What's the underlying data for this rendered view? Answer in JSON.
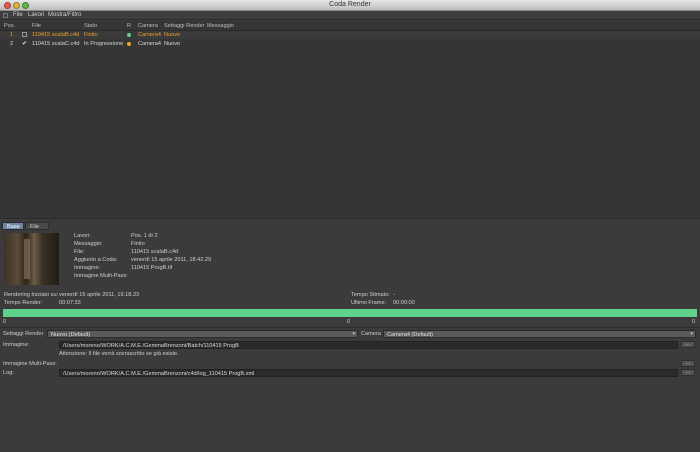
{
  "window": {
    "title": "Coda Render"
  },
  "menu": {
    "items": [
      "File",
      "Lavori",
      "Mostra/Filtro"
    ]
  },
  "jobs": {
    "columns": {
      "pos": "Pos.",
      "file": "File",
      "stato": "Stato",
      "r": "R",
      "camera": "Camera",
      "settaggi": "Settaggi Render",
      "messaggio": "Messaggio"
    },
    "rows": [
      {
        "pos": "1",
        "file": "110415 scalaB.c4d",
        "stato": "Finito",
        "camera": "Camera4",
        "settaggi": "Nuovo",
        "dot_color": "#5fd18c",
        "text_color": "#f0a326"
      },
      {
        "pos": "2",
        "file": "110415 scalaC.c4d",
        "stato": "In Progressione",
        "camera": "Camera4",
        "settaggi": "Nuovo",
        "dot_color": "#f0a326",
        "text_color": "#dadada"
      }
    ]
  },
  "tabs": {
    "base": "Base",
    "file_log": "File Log"
  },
  "details": {
    "lavori_label": "Lavori:",
    "lavori_value": "Pos. 1 di 2",
    "messaggio_label": "Messaggio:",
    "messaggio_value": "Finito",
    "file_label": "File:",
    "file_value": "110415 scalaB.c4d",
    "aggiunto_label": "Aggiunto a Coda:",
    "aggiunto_value": "venerdì 15 aprile 2011, 18.42.29",
    "immagine_label": "Immagine:",
    "immagine_value": "110415 ProgB.tif",
    "multipass_label": "Immagine Multi-Pass:"
  },
  "stats": {
    "rendering_label": "Rendering Iniziato su:",
    "rendering_value": "venerdì 15 aprile 2011, 19.18.33",
    "tempo_render_label": "Tempo Render:",
    "tempo_render_value": "00:07:33",
    "tempo_stimato_label": "Tempo Stimato:",
    "tempo_stimato_value": "-",
    "ultimo_frame_label": "Ultimo Frame:",
    "ultimo_frame_value": "00:00:00"
  },
  "progress": {
    "fraction": 1.0,
    "tick_left": "0",
    "tick_mid": "0",
    "tick_right": "0",
    "color": "#5fd18c"
  },
  "settings": {
    "settaggi_label": "Settaggi Render",
    "settaggi_value": "Nuovo (Default)",
    "camera_label": "Camera",
    "camera_value": "Camera4 (Default)",
    "immagine_label": "Immagine:",
    "immagine_path": "/Users/moreno/WORK/A.C.M.E./GemmaBrenzoni/Batch/110415 ProgB",
    "warning": "Attenzione: Il file verrà sovrascritto se già esiste.",
    "multipass_label": "Immagine Multi-Pass:",
    "log_label": "Log:",
    "log_path": "/Users/moreno/WORK/A.C.M.E./GemmaBrenzoni/c4d/log_110415 ProgB.xml",
    "browse_label": "..."
  }
}
